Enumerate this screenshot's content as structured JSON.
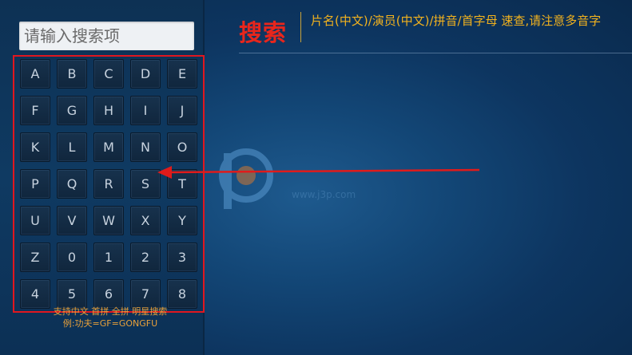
{
  "search": {
    "placeholder": "请输入搜索项"
  },
  "keyboard": {
    "keys": [
      "A",
      "B",
      "C",
      "D",
      "E",
      "F",
      "G",
      "H",
      "I",
      "J",
      "K",
      "L",
      "M",
      "N",
      "O",
      "P",
      "Q",
      "R",
      "S",
      "T",
      "U",
      "V",
      "W",
      "X",
      "Y",
      "Z",
      "0",
      "1",
      "2",
      "3",
      "4",
      "5",
      "6",
      "7",
      "8"
    ]
  },
  "hint": {
    "line1": "支持中文 首拼 全拼 明星搜索",
    "line2": "例:功夫=GF=GONGFU"
  },
  "header": {
    "title": "搜索",
    "instruction": "片名(中文)/演员(中文)/拼音/首字母 速查,请注意多音字"
  },
  "watermark": {
    "domain": "www.j3p.com"
  },
  "colors": {
    "accent_red": "#e8261c",
    "instruction_orange": "#f2b21e",
    "highlight_frame": "#e0171f",
    "background": "#134777"
  }
}
